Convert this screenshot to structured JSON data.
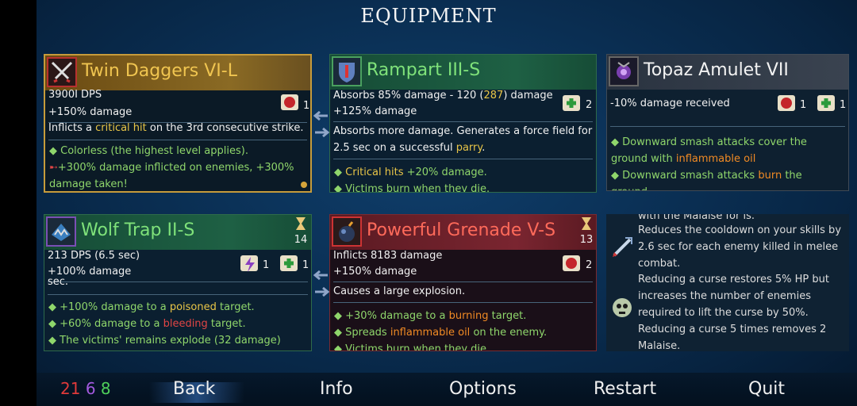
{
  "title": "EQUIPMENT",
  "cards": [
    {
      "name": "Twin Daggers VI-L",
      "stat1": "3900Ι DPS",
      "stat2": "+150% damage",
      "scroll_count": "1",
      "desc_a": "Inflicts a ",
      "desc_b": "critical hit",
      "desc_c": " on the 3rd consecutive strike.",
      "aff1": "Colorless (the highest level applies).",
      "aff2": "+300% damage inflicted on enemies, +300% damage taken!"
    },
    {
      "name": "Rampart III-S",
      "stat1_a": "Absorbs 85% damage - 120 (",
      "stat1_b": "287",
      "stat1_c": ") damage",
      "stat2": "+125% damage",
      "scroll_count": "2",
      "desc_a": "Absorbs more damage. Generates a force field for 2.5 sec on a successful ",
      "desc_b": "parry",
      "desc_c": ".",
      "aff1_a": "Critical hits",
      "aff1_b": " +20% damage.",
      "aff2": "Victims burn when they die."
    },
    {
      "name": "Topaz Amulet VII",
      "stat1": "-10% damage received",
      "scroll_count_a": "1",
      "scroll_count_b": "1",
      "aff1_a": "Downward smash attacks cover the ground with ",
      "aff1_b": "inflammable oil",
      "aff2_a": "Downward smash attacks ",
      "aff2_b": "burn",
      "aff2_c": " the ground."
    },
    {
      "name": "Wolf Trap II-S",
      "cooldown": "14",
      "stat1": "213 DPS (6.5 sec)",
      "stat2": "+100% damage",
      "scroll_count_a": "1",
      "scroll_count_b": "1",
      "desc": "sec.",
      "aff1_a": "+100% damage to a ",
      "aff1_b": "poisoned",
      "aff1_c": " target.",
      "aff2_a": "+60% damage to a ",
      "aff2_b": "bleeding",
      "aff2_c": " target.",
      "aff3": "The victims' remains explode (32 damage)"
    },
    {
      "name": "Powerful Grenade V-S",
      "cooldown": "13",
      "stat1": "Inflicts 8183 damage",
      "stat2": "+150% damage",
      "scroll_count": "2",
      "desc": "Causes a large explosion.",
      "aff1_a": "+30% damage to a ",
      "aff1_b": "burning",
      "aff1_c": " target.",
      "aff2_a": "Spreads ",
      "aff2_b": "inflammable oil",
      "aff2_c": " on the enemy.",
      "aff3": "Victims burn when they die."
    }
  ],
  "mutations": [
    {
      "text": "with the Malaise for is."
    },
    {
      "text": "Reduces the cooldown on your skills by 2.6 sec for each enemy killed in melee combat."
    },
    {
      "text": "Reducing a curse restores 5% HP but increases the number of enemies required to lift the curse by 50%. Reducing a curse 5 times removes 2 Malaise."
    }
  ],
  "stats": {
    "brutality": "21",
    "tactics": "6",
    "survival": "8"
  },
  "nav": {
    "back": "Back",
    "info": "Info",
    "options": "Options",
    "restart": "Restart",
    "quit": "Quit"
  },
  "colors": {
    "brutality": "#e03a3a",
    "tactics": "#a45ae0",
    "survival": "#4fd05a",
    "highlight": "#e8c547",
    "fire": "#f08a24"
  }
}
